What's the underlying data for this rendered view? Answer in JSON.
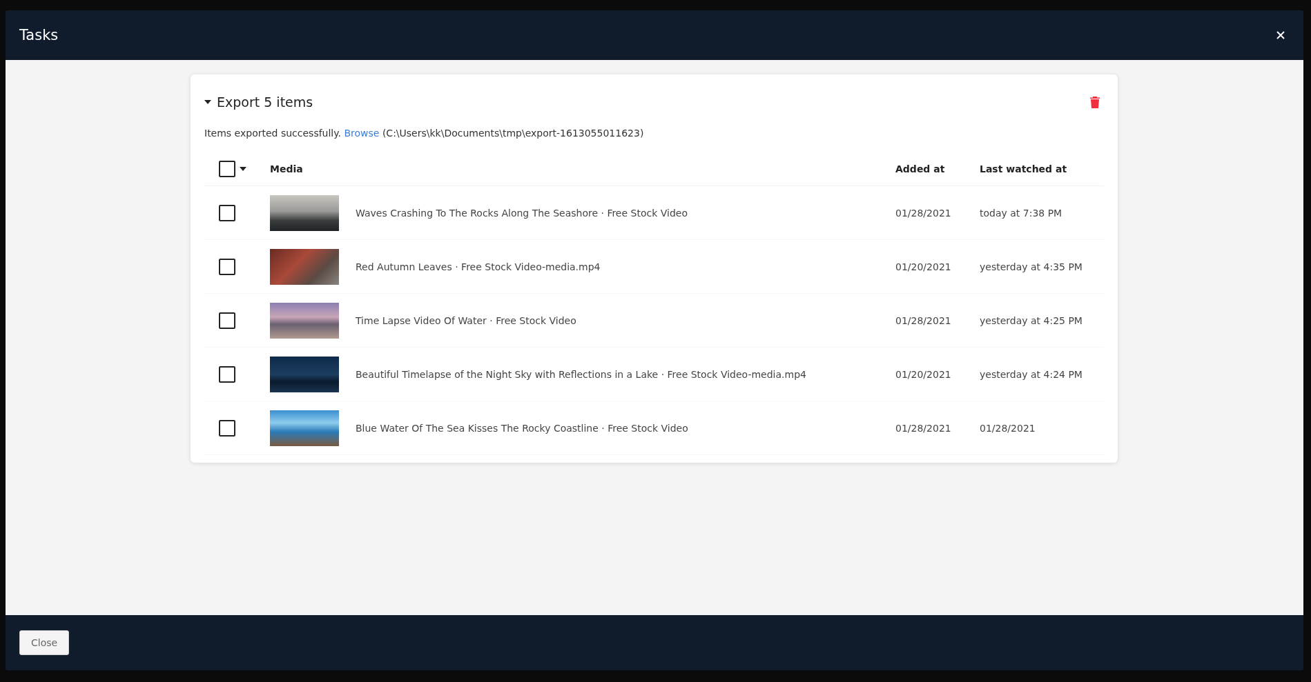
{
  "dialog": {
    "title": "Tasks"
  },
  "task": {
    "title": "Export 5 items",
    "expanded": true,
    "message": "Items exported successfully.",
    "link": "Browse",
    "path": "(C:\\Users\\kk\\Documents\\tmp\\export-1613055011623)"
  },
  "table": {
    "select_all": {
      "checked": false
    },
    "columns": [
      "Media",
      "Added at",
      "Last watched at"
    ],
    "rows": [
      {
        "checked": false,
        "title": "Waves Crashing To The Rocks Along The Seashore · Free Stock Video",
        "added": "01/28/2021",
        "watched": "today at 7:38 PM"
      },
      {
        "checked": false,
        "title": "Red Autumn Leaves · Free Stock Video-media.mp4",
        "added": "01/20/2021",
        "watched": "yesterday at 4:35 PM"
      },
      {
        "checked": false,
        "title": "Time Lapse Video Of Water · Free Stock Video",
        "added": "01/28/2021",
        "watched": "yesterday at 4:25 PM"
      },
      {
        "checked": false,
        "title": "Beautiful Timelapse of the Night Sky with Reflections in a Lake · Free Stock Video-media.mp4",
        "added": "01/20/2021",
        "watched": "yesterday at 4:24 PM"
      },
      {
        "checked": false,
        "title": "Blue Water Of The Sea Kisses The Rocky Coastline · Free Stock Video",
        "added": "01/28/2021",
        "watched": "01/28/2021"
      }
    ]
  },
  "footer": {
    "button": "Close"
  }
}
